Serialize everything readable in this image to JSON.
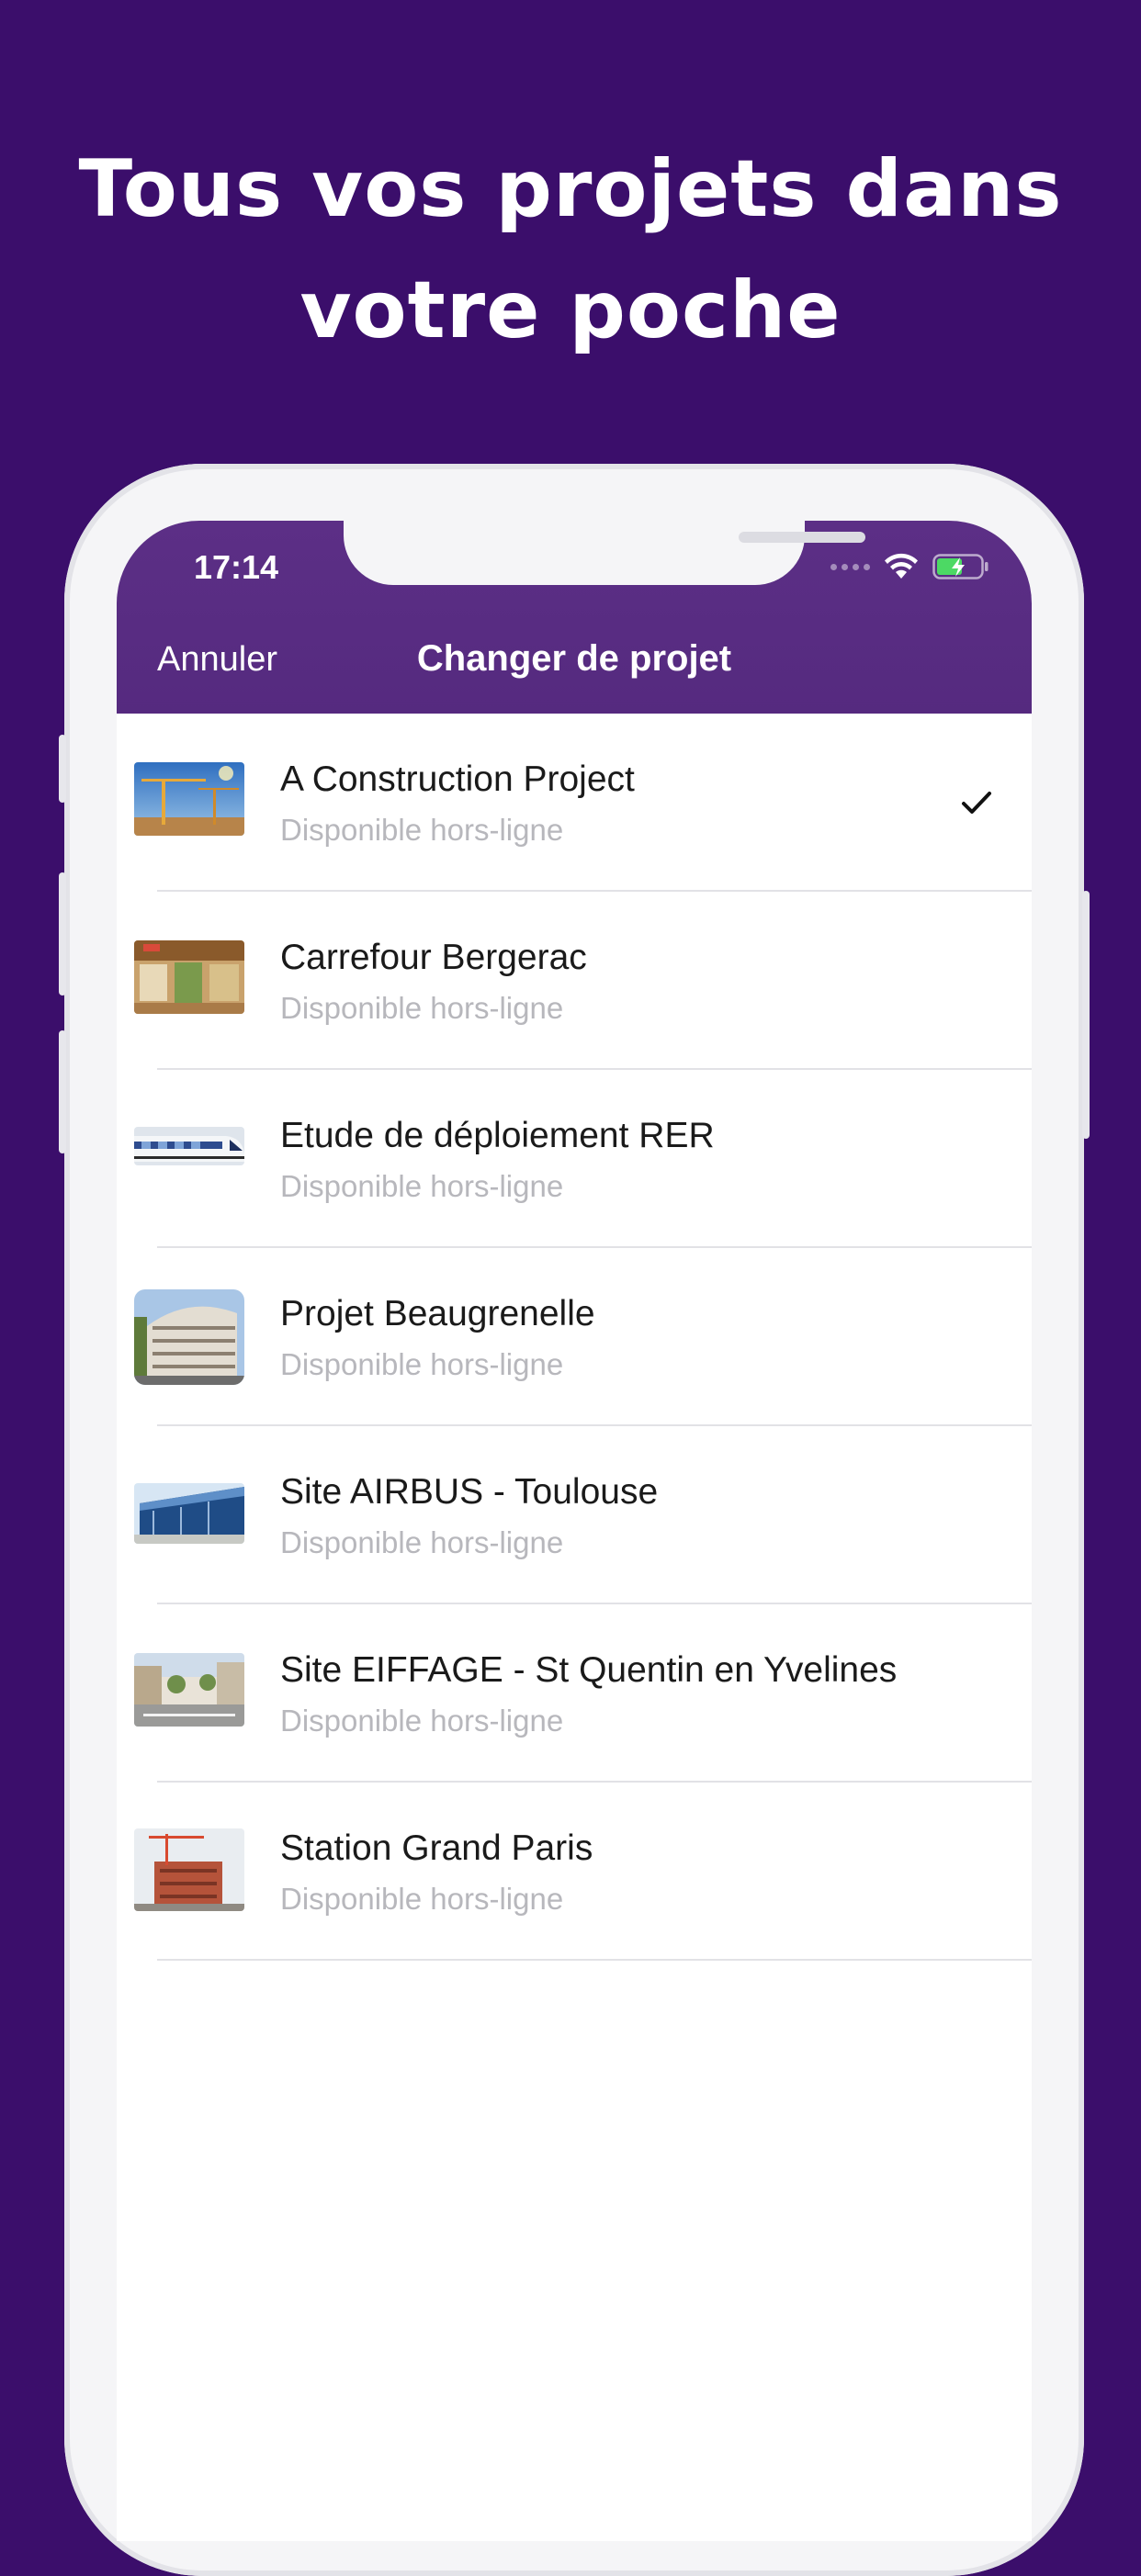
{
  "headline": {
    "line1": "Tous vos projets dans",
    "line2": "votre poche"
  },
  "status_bar": {
    "time": "17:14",
    "icons": [
      "cellular-signal-icon",
      "wifi-icon",
      "battery-charging-icon"
    ]
  },
  "nav": {
    "cancel_label": "Annuler",
    "title": "Changer de projet"
  },
  "projects": [
    {
      "name": "A Construction Project",
      "subtitle": "Disponible hors-ligne",
      "selected": true,
      "thumbnail": "construction-cranes-thumbnail"
    },
    {
      "name": "Carrefour Bergerac",
      "subtitle": "Disponible hors-ligne",
      "selected": false,
      "thumbnail": "supermarket-thumbnail"
    },
    {
      "name": "Etude de déploiement RER",
      "subtitle": "Disponible hors-ligne",
      "selected": false,
      "thumbnail": "train-thumbnail"
    },
    {
      "name": "Projet Beaugrenelle",
      "subtitle": "Disponible hors-ligne",
      "selected": false,
      "thumbnail": "building-thumbnail"
    },
    {
      "name": "Site AIRBUS - Toulouse",
      "subtitle": "Disponible hors-ligne",
      "selected": false,
      "thumbnail": "glass-office-thumbnail"
    },
    {
      "name": "Site EIFFAGE - St Quentin en Yvelines",
      "subtitle": "Disponible hors-ligne",
      "selected": false,
      "thumbnail": "street-thumbnail"
    },
    {
      "name": "Station Grand Paris",
      "subtitle": "Disponible hors-ligne",
      "selected": false,
      "thumbnail": "construction-site-thumbnail"
    }
  ],
  "colors": {
    "background": "#3b0e6b",
    "nav_bar": "#5a2d83",
    "title_text": "#1a1a1a",
    "subtitle_text": "#b7b7bc",
    "battery_green": "#4cd964"
  }
}
